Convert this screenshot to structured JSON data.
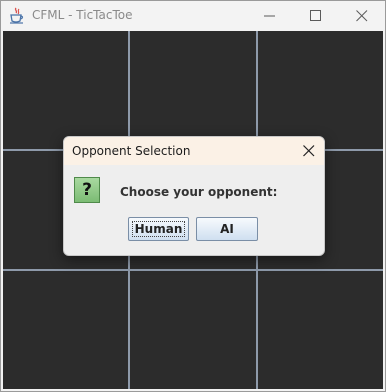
{
  "window": {
    "title": "CFML - TicTacToe",
    "app_icon": "java-cup-icon",
    "controls": [
      "minimize-icon",
      "maximize-icon",
      "close-icon"
    ]
  },
  "board": {
    "rows": 3,
    "cols": 3,
    "cells": [
      "",
      "",
      "",
      "",
      "",
      "",
      "",
      "",
      ""
    ],
    "background_color": "#2c2c2c",
    "grid_color": "#8e9aaa"
  },
  "dialog": {
    "title": "Opponent Selection",
    "icon": "question-icon",
    "icon_glyph": "?",
    "message": "Choose your opponent:",
    "buttons": {
      "human": "Human",
      "ai": "AI"
    },
    "focused_button": "Human"
  }
}
